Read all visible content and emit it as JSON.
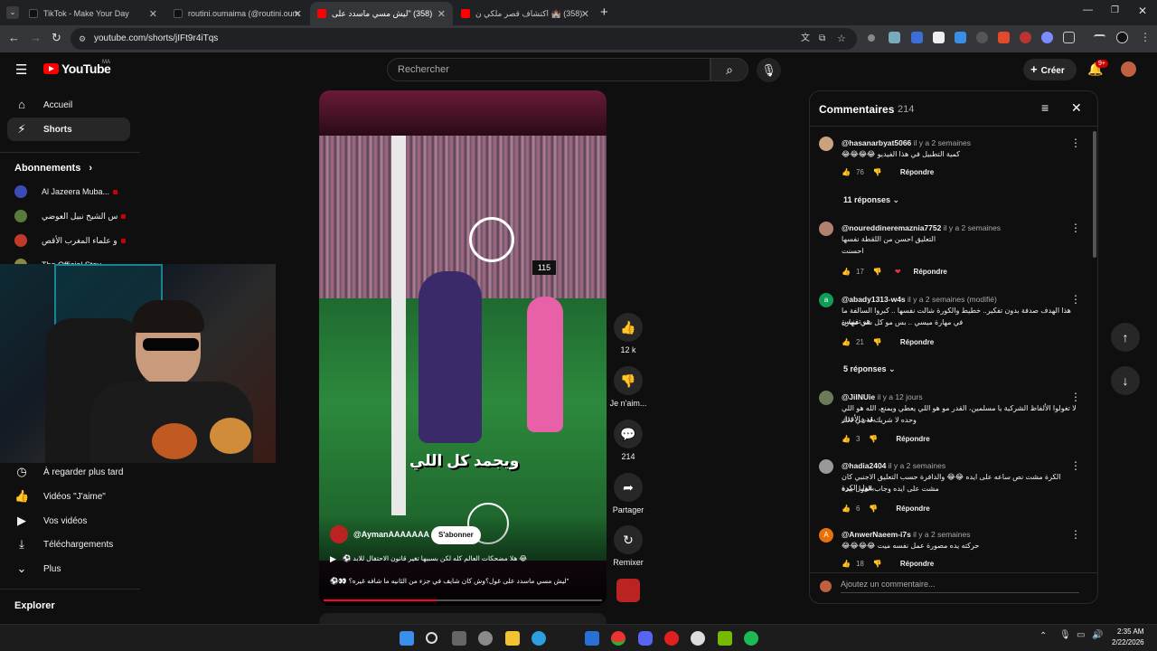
{
  "browser": {
    "tabs": [
      {
        "title": "TikTok - Make Your Day",
        "active": false,
        "color": "#111111"
      },
      {
        "title": "routini.oumaima (@routini.oum",
        "active": false,
        "color": "#111111"
      },
      {
        "title": "(358) \"ليش مسي ماسدد على",
        "active": true,
        "color": "#ff0000"
      },
      {
        "title": "(358) 🏰 اكتشاف قصر ملكي ن",
        "active": false,
        "color": "#ff0000"
      }
    ],
    "new_tab": "+",
    "url": "youtube.com/shorts/jIFt9r4iTqs"
  },
  "youtube": {
    "logo_text": "YouTube",
    "logo_region": "MA",
    "search_placeholder": "Rechercher",
    "create_label": "Créer",
    "notifications_badge": "9+"
  },
  "sidebar": {
    "main": [
      {
        "label": "Accueil",
        "icon": "home-icon",
        "active": false
      },
      {
        "label": "Shorts",
        "icon": "shorts-icon",
        "active": true
      }
    ],
    "subscriptions_header": "Abonnements",
    "subscriptions": [
      {
        "label": "Al Jazeera Muba...",
        "color": "#3b4bb8"
      },
      {
        "label": "س الشيخ نبيل العوضي",
        "color": "#5a7a3a"
      },
      {
        "label": "و علماء المغرب الأقص",
        "color": "#c0392b"
      },
      {
        "label": "The Official Stev",
        "color": "#884"
      }
    ],
    "you_items": [
      {
        "label": "À regarder plus tard",
        "icon": "clock-icon"
      },
      {
        "label": "Vidéos \"J'aime\"",
        "icon": "like-icon"
      },
      {
        "label": "Vos vidéos",
        "icon": "video-icon"
      },
      {
        "label": "Téléchargements",
        "icon": "download-icon"
      },
      {
        "label": "Plus",
        "icon": "chevron-down-icon"
      }
    ],
    "explore_header": "Explorer"
  },
  "short": {
    "overlay_caption": "ويجمد كل اللي",
    "scoreboard": "115",
    "channel": "@AymanAAAAAAA",
    "subscribe_label": "S'abonner",
    "description": "😂 هلا مضحكات العالم كله لكن بسببها تغير قانون الاحتفال للابد ⚽",
    "subtitle_line": "\"ليش مسي ماسدد على غول؟وش كان شايف في جزء من الثانيه ما شافه غيره؟ 👀⚽",
    "actions": [
      {
        "label": "12 k",
        "icon": "thumbs-up-icon"
      },
      {
        "label": "Je n'aim...",
        "icon": "thumbs-down-icon"
      },
      {
        "label": "214",
        "icon": "comment-icon"
      },
      {
        "label": "Partager",
        "icon": "share-icon"
      },
      {
        "label": "Remixer",
        "icon": "remix-icon"
      }
    ]
  },
  "comments": {
    "title": "Commentaires",
    "count": "214",
    "reply_label": "Répondre",
    "add_placeholder": "Ajoutez un commentaire...",
    "items": [
      {
        "author": "@hasanarbyat5066",
        "time": "il y a 2 semaines",
        "text": "كمية التطبيل في هذا الفيديو 😂😂😂😂",
        "likes": "76",
        "avatar_color": "#c9a27e",
        "avatar_letter": ""
      },
      {
        "author": "@noureddineremaznia7752",
        "time": "il y a 2 semaines",
        "text": "التعليق احسن من اللقطة نفسها",
        "text2": "احسنت",
        "likes": "17",
        "avatar_color": "#b08070",
        "avatar_letter": ""
      },
      {
        "author": "@abady1313-w4s",
        "time": "il y a 2 semaines (modifié)",
        "text": "هذا الهدف صدفة بدون تفكير.. خطيط والكورة شالت نفسها .. كبروا السالفة ما هو تفنيس",
        "text2": "في مهارة ميسي .. بس مو كل شي مهارة",
        "likes": "21",
        "avatar_color": "#0f9d58",
        "avatar_letter": "a"
      },
      {
        "author": "@JilNUie",
        "time": "il y a 12 jours",
        "text": "لا تغولوا الألفاظ الشركية يا مسلمين، القدر مو هو اللي يعطي ويمنع، الله هو اللي يقدر الأقدار",
        "text2": "وحده لا شريك له في ذلك",
        "likes": "3",
        "avatar_color": "#6a7a5a",
        "avatar_letter": ""
      },
      {
        "author": "@hadia2404",
        "time": "il y a 2 semaines",
        "text": "الكرة مشت نص ساعه على ايده 😂😂 والدافرة حسب التعليق الاجنبي كان يقول الكرة",
        "text2": "مشت على ايده وجاب القول بيده",
        "likes": "6",
        "avatar_color": "#999999",
        "avatar_letter": ""
      },
      {
        "author": "@AnwerNaeem-i7s",
        "time": "il y a 2 semaines",
        "text": "حركته يده مصورة عمل نفسه ميت 😂😂😂😂",
        "likes": "18",
        "avatar_color": "#e8710a",
        "avatar_letter": "A"
      }
    ],
    "reply_toggles": [
      "11 réponses",
      "5 réponses"
    ]
  },
  "taskbar": {
    "time": "2:35 AM",
    "date": "2/22/2026"
  }
}
